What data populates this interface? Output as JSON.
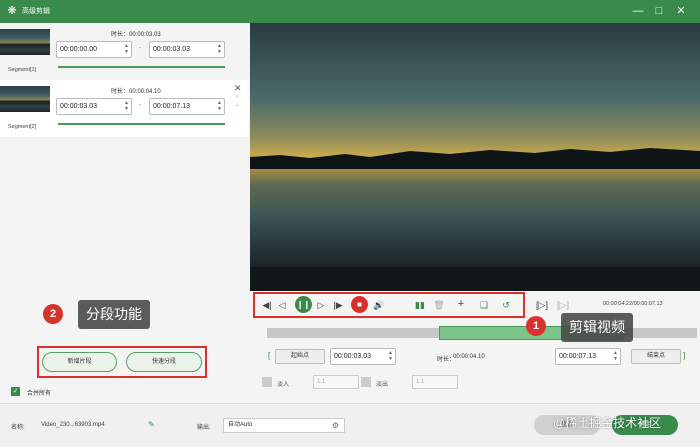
{
  "window": {
    "title": "高级剪辑",
    "minimize_icon": "minimize-icon",
    "maximize_icon": "maximize-icon",
    "close_icon": "close-icon"
  },
  "segments": [
    {
      "label": "Segment[1]",
      "duration_prefix": "时长：",
      "duration": "00:00:03.03",
      "start": "00:00:00.00",
      "end": "00:00:03.03"
    },
    {
      "label": "Segment[2]",
      "duration_prefix": "时长：",
      "duration": "00:00:04.10",
      "start": "00:00:03.03",
      "end": "00:00:07.13"
    }
  ],
  "left_actions": {
    "new_segment": "新增片段",
    "quick_split": "快速分段"
  },
  "merge": {
    "label": "合并所有",
    "checked": true
  },
  "callouts": [
    {
      "number": "1",
      "text": "剪辑视频"
    },
    {
      "number": "2",
      "text": "分段功能"
    }
  ],
  "player": {
    "timecode": "00:00:04.22/00:00:07.13",
    "selection_start_fraction": 0.4,
    "selection_end_fraction": 0.83
  },
  "trim": {
    "start_label": "起始点",
    "start_value": "00:00:03.03",
    "duration_label": "时长：",
    "duration_value": "00:00:04.10",
    "end_value": "00:00:07.13",
    "end_label": "结束点"
  },
  "fade": {
    "in_label": "淡入",
    "in_value": "1.1",
    "out_label": "淡出",
    "out_value": "1.1"
  },
  "bottom": {
    "name_label": "名称:",
    "file_name": "Video_230...63903.mp4",
    "output_label": "输出:",
    "output_value": "自动Auto",
    "reset": "重置",
    "ok": "确定"
  },
  "watermark": "@稀土掘金技术社区",
  "colors": {
    "brand": "#3a8a4c",
    "accent_red": "#d8322c",
    "selection": "#7ec58c"
  }
}
